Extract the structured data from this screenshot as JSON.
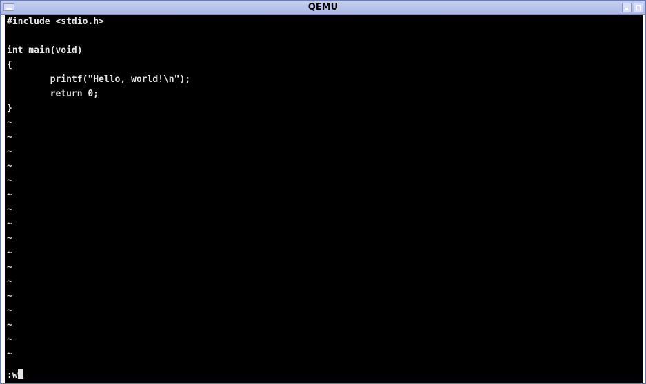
{
  "window": {
    "title": "QEMU"
  },
  "editor": {
    "lines": [
      "#include <stdio.h>",
      "",
      "int main(void)",
      "{",
      "        printf(\"Hello, world!\\n\");",
      "        return 0;",
      "}"
    ],
    "empty_line_marker": "~",
    "command_line": ":w"
  },
  "colors": {
    "screen_bg": "#000000",
    "text": "#e6e6e6",
    "titlebar": "#aab8e6"
  }
}
